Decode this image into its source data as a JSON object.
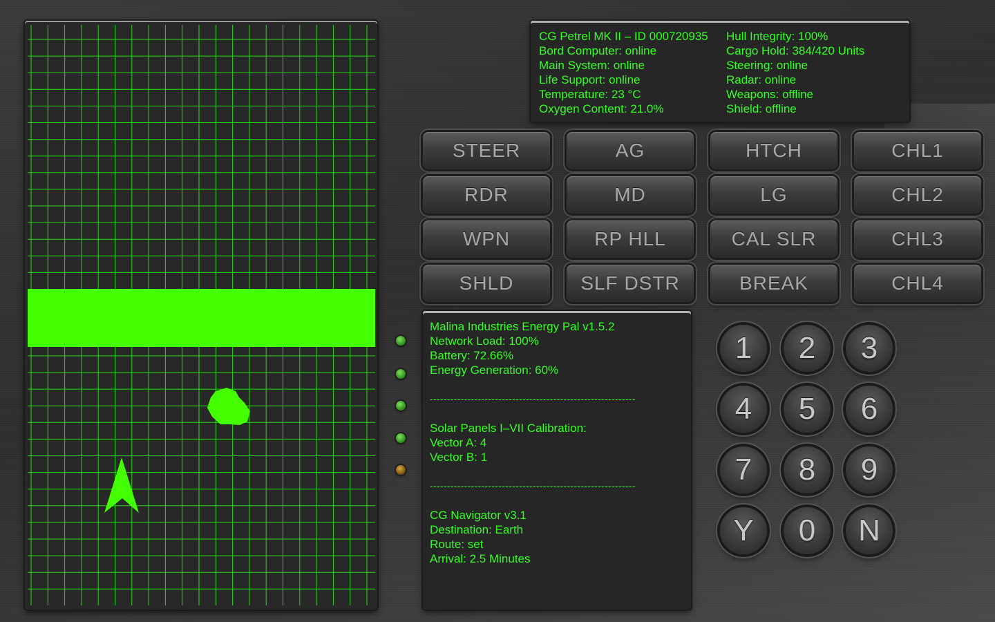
{
  "colors": {
    "screen_text": "#33ff22",
    "grid": "#22dd11",
    "bright_green": "#44ff00",
    "led_green": "#3aa52a",
    "led_amber": "#a07a1a",
    "button_text": "#a8a8a8",
    "key_text": "#c8c8c8"
  },
  "status": {
    "left": [
      "CG Petrel MK II – ID 000720935",
      "Bord Computer: online",
      "Main System: online",
      "Life Support: online",
      "Temperature: 23 °C",
      "Oxygen Content: 21.0%"
    ],
    "right": [
      "Hull Integrity: 100%",
      "Cargo Hold: 384/420 Units",
      "Steering: online",
      "Radar: online",
      "Weapons: offline",
      "Shield: offline"
    ]
  },
  "function_buttons": [
    [
      "STEER",
      "AG",
      "HTCH",
      "CHL1"
    ],
    [
      "RDR",
      "MD",
      "LG",
      "CHL2"
    ],
    [
      "WPN",
      "RP HLL",
      "CAL SLR",
      "CHL3"
    ],
    [
      "SHLD",
      "SLF DSTR",
      "BREAK",
      "CHL4"
    ]
  ],
  "leds": [
    "green",
    "green",
    "green",
    "green",
    "amber"
  ],
  "energy": {
    "title": "Malina Industries Energy Pal v1.5.2",
    "network": "Network Load: 100%",
    "battery": "Battery: 72.66%",
    "generation": "Energy Generation: 60%",
    "divider": "------------------------------------------------------------",
    "solar_title": "Solar Panels I–VII Calibration:",
    "vector_a": "Vector A: 4",
    "vector_b": "Vector B: 1",
    "nav_title": "CG Navigator v3.1",
    "destination": "Destination: Earth",
    "route": "Route: set",
    "arrival": "Arrival: 2.5 Minutes"
  },
  "keypad": [
    [
      "1",
      "2",
      "3"
    ],
    [
      "4",
      "5",
      "6"
    ],
    [
      "7",
      "8",
      "9"
    ],
    [
      "Y",
      "0",
      "N"
    ]
  ],
  "radar": {
    "objects": [
      "barrier-band",
      "asteroid",
      "ship-arrow"
    ]
  }
}
